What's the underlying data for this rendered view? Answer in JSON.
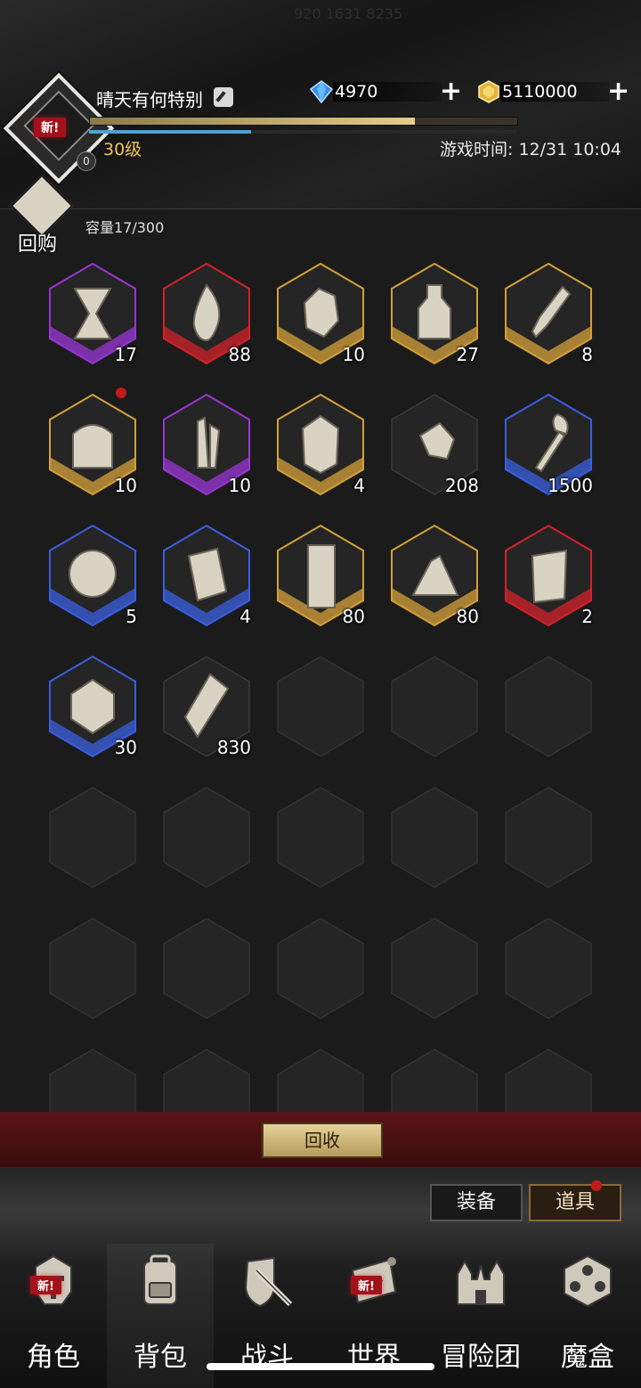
{
  "status_bar": {
    "text": "920 1631 8235"
  },
  "profile": {
    "new_badge": "新!",
    "avatar_count": "0",
    "name": "晴天有何特别",
    "level": "30级",
    "xp_fraction": 0.76,
    "mp_fraction": 0.38
  },
  "currency": {
    "gems": "4970",
    "gold": "5110000",
    "plus": "+"
  },
  "game_time": "游戏时间: 12/31 10:04",
  "buyback": {
    "label": "回购"
  },
  "capacity": "容量17/300",
  "items": [
    {
      "name": "hourglass",
      "qty": "17",
      "rarity": "purple",
      "dot": false
    },
    {
      "name": "flame",
      "qty": "88",
      "rarity": "red",
      "dot": false
    },
    {
      "name": "stone",
      "qty": "10",
      "rarity": "gold",
      "dot": false
    },
    {
      "name": "sand-bottle",
      "qty": "27",
      "rarity": "gold",
      "dot": false
    },
    {
      "name": "crystal-shard",
      "qty": "8",
      "rarity": "gold",
      "dot": false
    },
    {
      "name": "treasure-chest",
      "qty": "10",
      "rarity": "gold",
      "dot": true
    },
    {
      "name": "crystals",
      "qty": "10",
      "rarity": "purple",
      "dot": false
    },
    {
      "name": "rune-stone",
      "qty": "4",
      "rarity": "gold",
      "dot": false
    },
    {
      "name": "cloth-scrap",
      "qty": "208",
      "rarity": "none",
      "dot": false
    },
    {
      "name": "torch",
      "qty": "1500",
      "rarity": "blue",
      "dot": false
    },
    {
      "name": "compass",
      "qty": "5",
      "rarity": "blue",
      "dot": false
    },
    {
      "name": "rune-tablet",
      "qty": "4",
      "rarity": "blue",
      "dot": false
    },
    {
      "name": "banner",
      "qty": "80",
      "rarity": "gold",
      "dot": false
    },
    {
      "name": "sand-pile",
      "qty": "80",
      "rarity": "gold",
      "dot": false
    },
    {
      "name": "scroll",
      "qty": "2",
      "rarity": "red",
      "dot": false
    },
    {
      "name": "hammer-emblem",
      "qty": "30",
      "rarity": "blue",
      "dot": false
    },
    {
      "name": "diamond-shard",
      "qty": "830",
      "rarity": "none",
      "dot": false
    }
  ],
  "recycle_button": "回收",
  "tabs": {
    "equip": "装备",
    "items": "道具"
  },
  "nav": [
    {
      "label": "角色",
      "icon": "helmet-icon",
      "new": "新!"
    },
    {
      "label": "背包",
      "icon": "backpack-icon",
      "new": ""
    },
    {
      "label": "战斗",
      "icon": "sword-shield-icon",
      "new": ""
    },
    {
      "label": "世界",
      "icon": "map-scroll-icon",
      "new": "新!"
    },
    {
      "label": "冒险团",
      "icon": "castle-icon",
      "new": ""
    },
    {
      "label": "魔盒",
      "icon": "magic-cube-icon",
      "new": ""
    }
  ],
  "colors": {
    "purple": "#9a35d6",
    "red": "#d2222a",
    "gold": "#d4a03a",
    "blue": "#3a5fe0",
    "none": "#3a3a3a"
  }
}
